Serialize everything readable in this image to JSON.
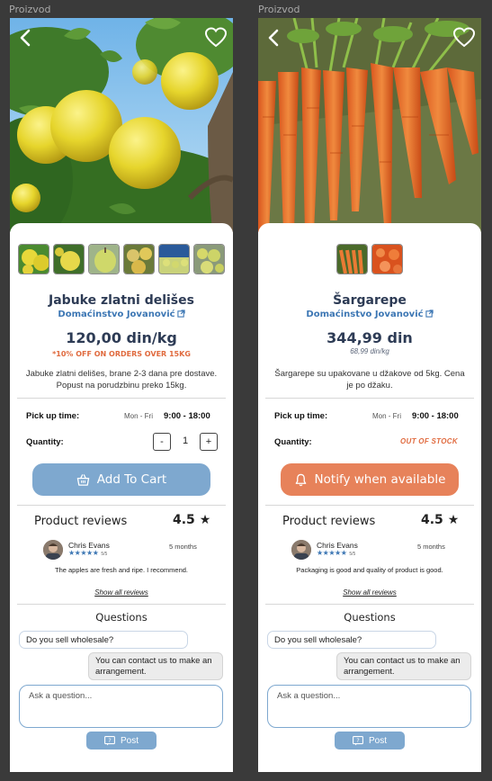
{
  "frame_label": "Proizvod",
  "products": [
    {
      "title": "Jabuke zlatni delišes",
      "farm": "Domaćinstvo Jovanović",
      "price": "120,00 din/kg",
      "promo": "*10% OFF ON ORDERS OVER 15KG",
      "description": "Jabuke zlatni delišes, brane 2-3 dana pre dostave. Popust na porudzbinu preko 15kg.",
      "pickup_label": "Pick up time:",
      "pickup_days": "Mon - Fri",
      "pickup_time": "9:00 - 18:00",
      "quantity_label": "Quantity:",
      "quantity_minus": "-",
      "quantity_value": "1",
      "quantity_plus": "+",
      "cta_label": "Add To Cart",
      "reviews_title": "Product reviews",
      "rating": "4.5",
      "reviewer_name": "Chris Evans",
      "reviewer_stars": "★★★★★",
      "reviewer_stars_count": "5/5",
      "review_when": "5 months",
      "review_text": "The apples are fresh and ripe. I recommend.",
      "show_all": "Show all reviews",
      "questions_title": "Questions",
      "question": "Do you sell wholesale?",
      "answer": "You can contact us to make an arrangement.",
      "ask_placeholder": "Ask a question...",
      "post_label": "Post"
    },
    {
      "title": "Šargarepe",
      "farm": "Domaćinstvo Jovanović",
      "price": "344,99 din",
      "sub_price": "68,99 din/kg",
      "description": "Šargarepe su upakovane u džakove od 5kg. Cena je po džaku.",
      "pickup_label": "Pick up time:",
      "pickup_days": "Mon - Fri",
      "pickup_time": "9:00 - 18:00",
      "quantity_label": "Quantity:",
      "stock_status": "OUT OF STOCK",
      "cta_label": "Notify when available",
      "reviews_title": "Product reviews",
      "rating": "4.5",
      "reviewer_name": "Chris Evans",
      "reviewer_stars": "★★★★★",
      "reviewer_stars_count": "5/5",
      "review_when": "5 months",
      "review_text": "Packaging is good and quality of product is good.",
      "show_all": "Show all reviews",
      "questions_title": "Questions",
      "question": "Do you sell wholesale?",
      "answer": "You can contact us to make an arrangement.",
      "ask_placeholder": "Ask a question...",
      "post_label": "Post"
    }
  ],
  "colors": {
    "primary_blue": "#7ea8cf",
    "accent_orange": "#e7825a",
    "title_navy": "#2d3b55",
    "link_blue": "#3d77b4"
  },
  "icons": [
    "back-arrow-icon",
    "heart-icon",
    "external-link-icon",
    "basket-icon",
    "bell-icon",
    "star-icon",
    "question-icon"
  ]
}
